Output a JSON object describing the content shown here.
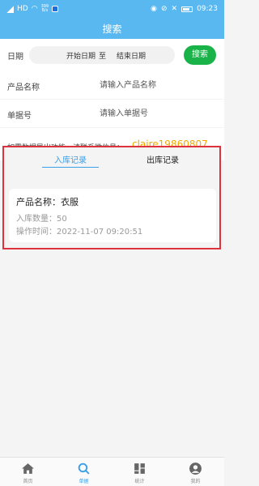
{
  "status_bar": {
    "network": "HD",
    "speed_value": "399",
    "speed_unit": "B/s",
    "time": "09:23",
    "app_icon": "bell-app-icon",
    "right_icons": [
      "eye-icon",
      "alarm-off-icon",
      "mute-icon",
      "battery-icon"
    ]
  },
  "navbar": {
    "title": "搜索"
  },
  "date_filter": {
    "label": "日期",
    "start_placeholder": "开始日期",
    "separator": "至",
    "end_placeholder": "结束日期",
    "search_label": "搜索"
  },
  "product_field": {
    "label": "产品名称",
    "placeholder": "请输入产品名称"
  },
  "receipt_field": {
    "label": "单据号",
    "placeholder": "请输入单据号"
  },
  "contact": {
    "text": "如需数据导出功能，请联系微信号：",
    "wechat_id": "claire19860807"
  },
  "tabs": [
    {
      "label": "入库记录",
      "active": true
    },
    {
      "label": "出库记录",
      "active": false
    }
  ],
  "records": [
    {
      "title": "产品名称：衣服",
      "quantity": "入库数量：50",
      "time": "操作时间：2022-11-07 09:20:51"
    }
  ],
  "bottom_nav": [
    {
      "label": "首页",
      "icon": "home-icon",
      "active": false
    },
    {
      "label": "单据",
      "icon": "search-icon",
      "active": true
    },
    {
      "label": "统计",
      "icon": "grid-icon",
      "active": false
    },
    {
      "label": "我的",
      "icon": "user-icon",
      "active": false
    }
  ],
  "colors": {
    "primary": "#5ab8f0",
    "search_button": "#1ab34a",
    "tab_active": "#3aa0e8",
    "wechat_id": "#f0a800",
    "highlight_border": "#e0323c"
  }
}
